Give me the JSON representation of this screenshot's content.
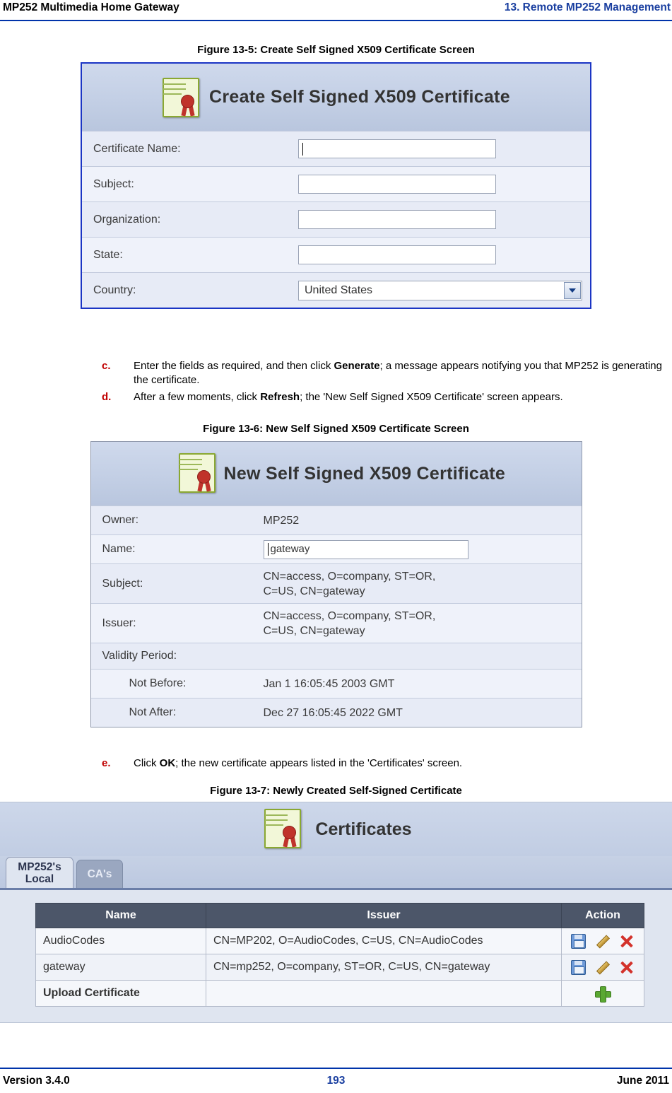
{
  "header": {
    "left": "MP252 Multimedia Home Gateway",
    "right": "13. Remote MP252 Management"
  },
  "footer": {
    "version": "Version 3.4.0",
    "page": "193",
    "date": "June 2011"
  },
  "figures": {
    "fig5_caption": "Figure 13-5: Create Self Signed X509 Certificate Screen",
    "fig6_caption": "Figure 13-6: New Self Signed X509 Certificate Screen",
    "fig7_caption": "Figure 13-7: Newly Created Self-Signed Certificate"
  },
  "steps": [
    {
      "marker": "c.",
      "parts": [
        {
          "t": "Enter the fields as required, and then click ",
          "b": false
        },
        {
          "t": "Generate",
          "b": true
        },
        {
          "t": "; a message appears notifying you that MP252 is generating the certificate.",
          "b": false
        }
      ]
    },
    {
      "marker": "d.",
      "parts": [
        {
          "t": "After a few moments, click ",
          "b": false
        },
        {
          "t": "Refresh",
          "b": true
        },
        {
          "t": "; the 'New Self Signed X509 Certificate' screen appears.",
          "b": false
        }
      ]
    },
    {
      "marker": "e.",
      "parts": [
        {
          "t": "Click ",
          "b": false
        },
        {
          "t": "OK",
          "b": true
        },
        {
          "t": "; the new certificate appears listed in the 'Certificates' screen.",
          "b": false
        }
      ]
    }
  ],
  "create_cert_screen": {
    "title": "Create Self Signed X509 Certificate",
    "icon": "certificate-icon",
    "fields": [
      {
        "label": "Certificate Name:",
        "value": "",
        "type": "text"
      },
      {
        "label": "Subject:",
        "value": "",
        "type": "text"
      },
      {
        "label": "Organization:",
        "value": "",
        "type": "text"
      },
      {
        "label": "State:",
        "value": "",
        "type": "text"
      },
      {
        "label": "Country:",
        "value": "United States",
        "type": "select"
      }
    ]
  },
  "new_cert_screen": {
    "title": "New Self Signed X509 Certificate",
    "icon": "certificate-icon",
    "rows": [
      {
        "label": "Owner:",
        "value": "MP252",
        "type": "text"
      },
      {
        "label": "Name:",
        "value": "gateway",
        "type": "input"
      },
      {
        "label": "Subject:",
        "value": "CN=access, O=company, ST=OR,\nC=US, CN=gateway",
        "type": "text"
      },
      {
        "label": "Issuer:",
        "value": "CN=access, O=company, ST=OR,\nC=US, CN=gateway",
        "type": "text"
      },
      {
        "label": "Validity Period:",
        "value": "",
        "type": "text"
      },
      {
        "label": "Not Before:",
        "value": "Jan 1 16:05:45 2003 GMT",
        "type": "indent"
      },
      {
        "label": "Not After:",
        "value": "Dec 27 16:05:45 2022 GMT",
        "type": "indent"
      }
    ]
  },
  "certificates_screen": {
    "title": "Certificates",
    "icon": "certificate-icon",
    "tabs": [
      {
        "label": "MP252's Local",
        "active": true
      },
      {
        "label": "CA's",
        "active": false
      }
    ],
    "table": {
      "columns": [
        "Name",
        "Issuer",
        "Action"
      ],
      "rows": [
        {
          "name": "AudioCodes",
          "issuer": "CN=MP202, O=AudioCodes, C=US, CN=AudioCodes",
          "actions": [
            "save-icon",
            "edit-pencil-icon",
            "delete-icon"
          ]
        },
        {
          "name": "gateway",
          "issuer": "CN=mp252, O=company, ST=OR, C=US, CN=gateway",
          "actions": [
            "save-icon",
            "edit-pencil-icon",
            "delete-icon"
          ]
        },
        {
          "name": "Upload Certificate",
          "issuer": "",
          "actions": [
            "add-plus-icon"
          ]
        }
      ]
    }
  },
  "colors": {
    "accent_blue": "#1a3fa0",
    "rule_blue": "#0033aa",
    "step_marker_red": "#c00000",
    "table_header": "#4c5669"
  }
}
